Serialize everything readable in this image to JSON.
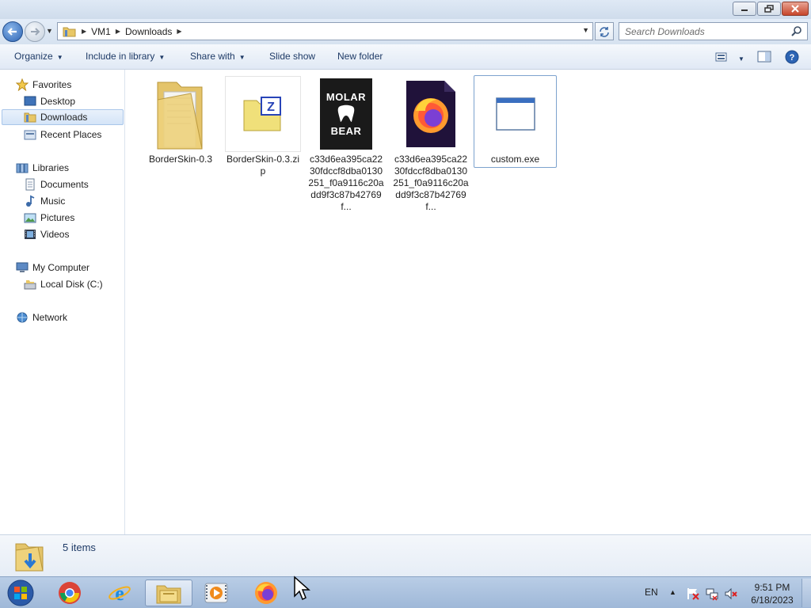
{
  "window": {
    "minimize_label": "Minimize",
    "maximize_label": "Restore",
    "close_label": "Close"
  },
  "address": {
    "root_crumb": "VM1",
    "current_crumb": "Downloads",
    "search_placeholder": "Search Downloads"
  },
  "toolbar": {
    "organize": "Organize",
    "include_in_library": "Include in library",
    "share_with": "Share with",
    "slide_show": "Slide show",
    "new_folder": "New folder"
  },
  "nav": {
    "favorites": "Favorites",
    "desktop": "Desktop",
    "downloads": "Downloads",
    "recent_places": "Recent Places",
    "libraries": "Libraries",
    "documents": "Documents",
    "music": "Music",
    "pictures": "Pictures",
    "videos": "Videos",
    "my_computer": "My Computer",
    "local_disk": "Local Disk (C:)",
    "network": "Network"
  },
  "files": [
    {
      "name": "BorderSkin-0.3",
      "icon": "folder-icon"
    },
    {
      "name": "BorderSkin-0.3.zip",
      "icon": "zip-archive-icon"
    },
    {
      "name": "c33d6ea395ca2230fdccf8dba0130251_f0a9116c20add9f3c87b42769f...",
      "icon": "molar-bear-image-icon",
      "thumb_text_top": "MOLAR",
      "thumb_text_bottom": "BEAR"
    },
    {
      "name": "c33d6ea395ca2230fdccf8dba0130251_f0a9116c20add9f3c87b42769f...",
      "icon": "firefox-file-icon"
    },
    {
      "name": "custom.exe",
      "icon": "application-window-icon"
    }
  ],
  "status": {
    "items_count": "5 items"
  },
  "taskbar": {
    "language": "EN",
    "time": "9:51 PM",
    "date": "6/18/2023"
  },
  "colors": {
    "accent": "#2d64b4",
    "toolbar_text": "#1e3a66"
  }
}
